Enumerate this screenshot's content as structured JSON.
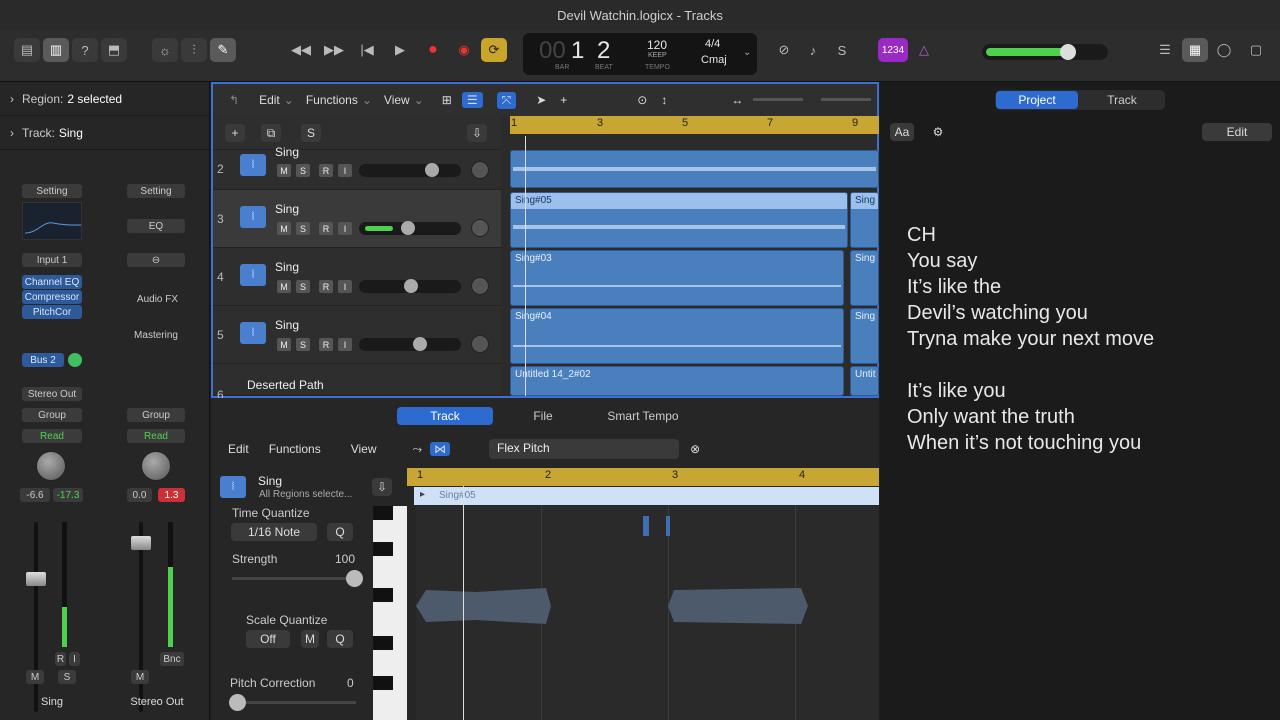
{
  "window": {
    "title": "Devil Watchin.logicx - Tracks"
  },
  "lcd": {
    "bar": "1",
    "beat": "2",
    "bar_label": "BAR",
    "beat_label": "BEAT",
    "tempo": "120",
    "keep": "KEEP",
    "tempo_label": "TEMPO",
    "sig": "4/4",
    "key": "Cmaj",
    "count_in": "1234"
  },
  "inspector": {
    "region_label": "Region:",
    "region_value": "2 selected",
    "track_label": "Track:",
    "track_value": "Sing",
    "setting": "Setting",
    "eq": "EQ",
    "input": "Input 1",
    "plugins": [
      "Channel EQ",
      "Compressor",
      "PitchCor"
    ],
    "audio_fx": "Audio FX",
    "mastering": "Mastering",
    "bus": "Bus 2",
    "stereo_out": "Stereo Out",
    "group": "Group",
    "read": "Read",
    "vol1": "-6.6",
    "peak1": "-17.3",
    "vol2": "0.0",
    "peak2": "1.3",
    "r": "R",
    "i": "I",
    "bnc": "Bnc",
    "m": "M",
    "s": "S",
    "ch1_name": "Sing",
    "ch2_name": "Stereo Out"
  },
  "tracks_toolbar": {
    "edit": "Edit",
    "functions": "Functions",
    "view": "View"
  },
  "tracks": [
    {
      "num": "2",
      "name": "Sing"
    },
    {
      "num": "3",
      "name": "Sing"
    },
    {
      "num": "4",
      "name": "Sing"
    },
    {
      "num": "5",
      "name": "Sing"
    },
    {
      "num": "6",
      "name": "Deserted Path"
    }
  ],
  "msri": {
    "m": "M",
    "s": "S",
    "r": "R",
    "i": "I"
  },
  "ruler": [
    "1",
    "3",
    "5",
    "7",
    "9"
  ],
  "regions": [
    {
      "label": "Sing#05"
    },
    {
      "label": "Sing"
    },
    {
      "label": "Sing#03"
    },
    {
      "label": "Sing"
    },
    {
      "label": "Sing#04"
    },
    {
      "label": "Sing"
    },
    {
      "label": "Untitled 14_2#02"
    },
    {
      "label": "Untit"
    }
  ],
  "bottom": {
    "tabs": [
      "Track",
      "File",
      "Smart Tempo"
    ],
    "edit": "Edit",
    "functions": "Functions",
    "view": "View",
    "flex": "Flex Pitch",
    "track_name": "Sing",
    "track_sub": "All Regions selecte...",
    "tq_label": "Time Quantize",
    "tq_value": "1/16 Note",
    "q": "Q",
    "strength_label": "Strength",
    "strength_value": "100",
    "sq_label": "Scale Quantize",
    "sq_value": "Off",
    "pc_label": "Pitch Correction",
    "pc_value": "0",
    "ruler": [
      "1",
      "2",
      "3",
      "4"
    ],
    "region": "Sing#05"
  },
  "right": {
    "tabs": [
      "Project",
      "Track"
    ],
    "aa": "Aa",
    "edit": "Edit",
    "lyrics": [
      "CH",
      "You say",
      "It’s like the",
      "Devil’s watching you",
      "Tryna make your next move",
      "",
      "It’s like you",
      "Only want the truth",
      "When it’s not touching you"
    ]
  }
}
